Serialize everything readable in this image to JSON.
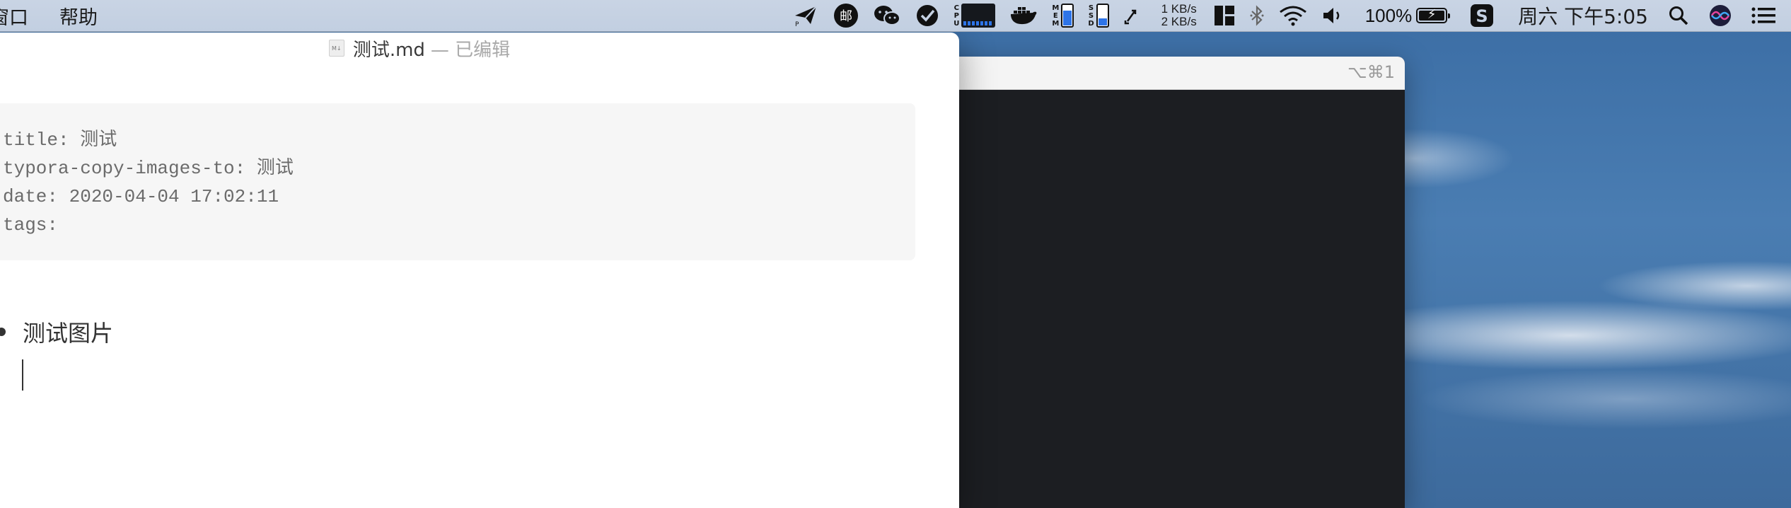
{
  "menubar": {
    "items": [
      "窗口",
      "帮助"
    ],
    "network": {
      "up": "1 KB/s",
      "down": "2 KB/s"
    },
    "meters": {
      "cpu_label": [
        "C",
        "P",
        "U"
      ],
      "mem_label": [
        "M",
        "E",
        "M"
      ],
      "ssd_label": [
        "S",
        "S",
        "D"
      ],
      "mem_level": 0.7,
      "ssd_level": 0.35
    },
    "battery": {
      "percent_text": "100%",
      "level": 1.0
    },
    "clock": "周六 下午5:05",
    "icons": [
      "paper-plane-icon",
      "mail-app-icon",
      "wechat-icon",
      "checklist-icon",
      "cpu-meter-icon",
      "docker-icon",
      "memory-meter-icon",
      "ssd-meter-icon",
      "arrows-icon",
      "window-layout-icon",
      "bluetooth-icon",
      "wifi-icon",
      "volume-icon",
      "battery-icon",
      "input-source-icon",
      "spotlight-search-icon",
      "siri-icon",
      "notification-center-icon"
    ]
  },
  "terminal": {
    "shortcut": "⌥⌘1",
    "background": "#1c1e22"
  },
  "editor": {
    "filename": "测试.md",
    "status": "— 已编辑",
    "front_matter": [
      "title: 测试",
      "typora-copy-images-to: 测试",
      "date: 2020-04-04 17:02:11",
      "tags:"
    ],
    "list_items": [
      "测试图片"
    ]
  },
  "colors": {
    "menubar": "#c5d1e2",
    "accent": "#2d74e8",
    "front_matter_bg": "#f6f6f6"
  }
}
